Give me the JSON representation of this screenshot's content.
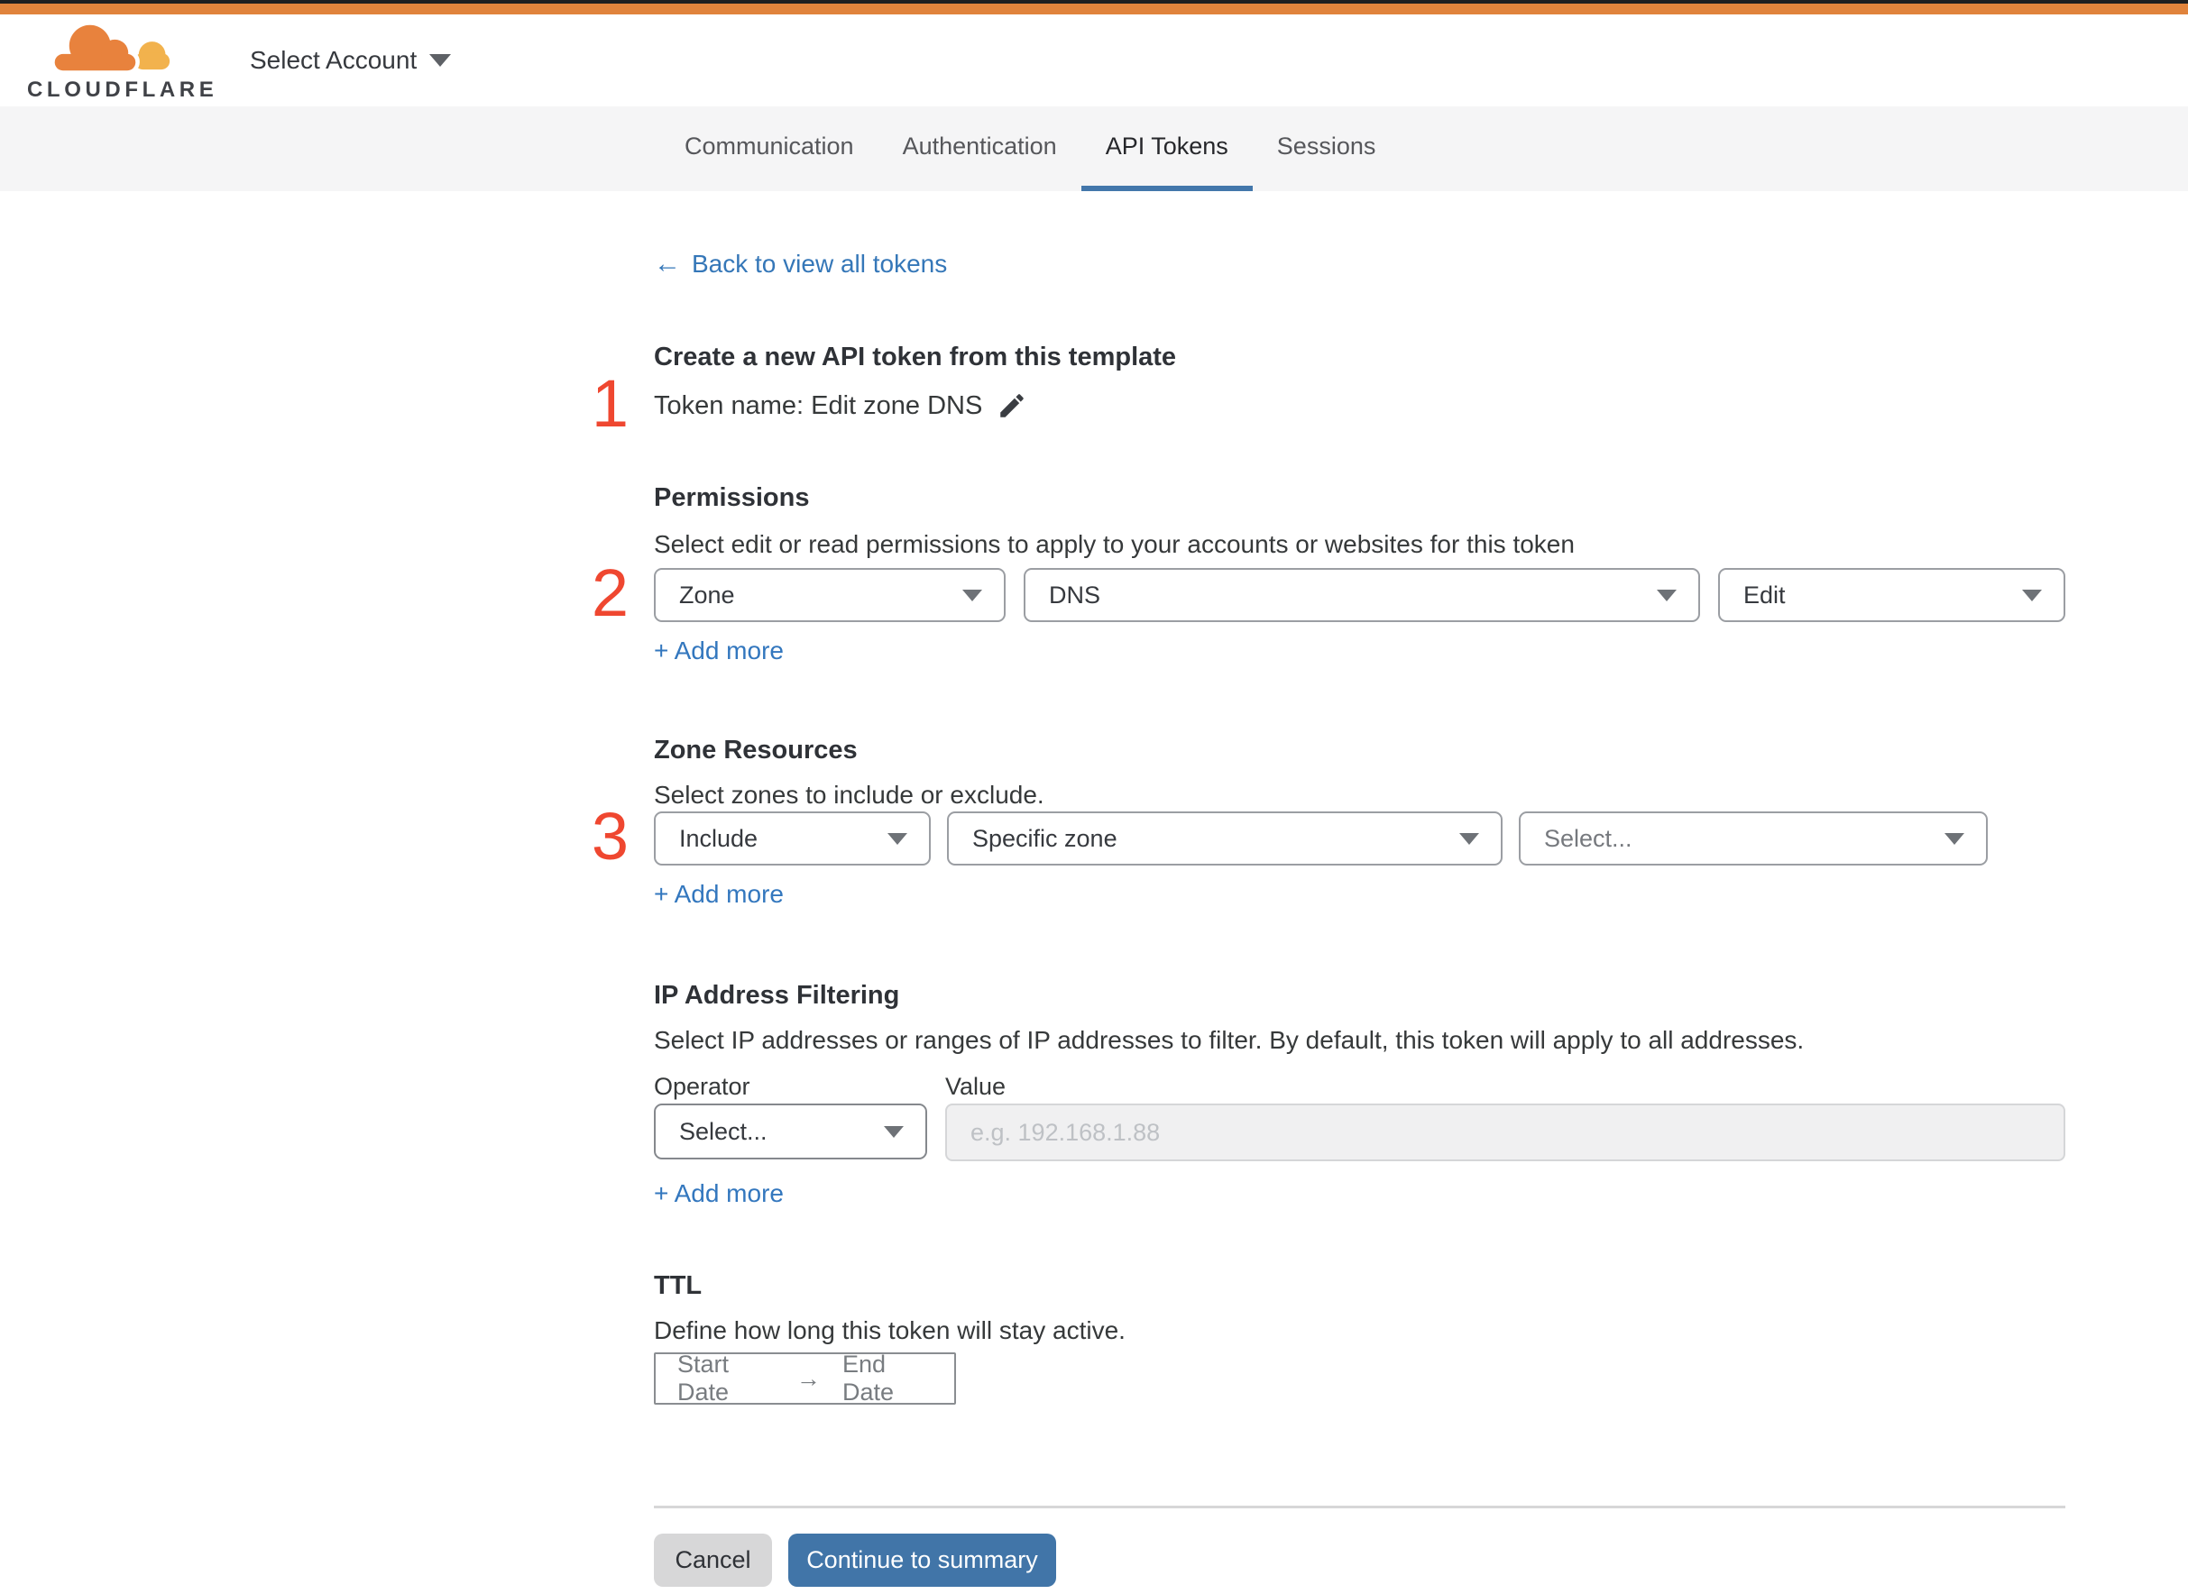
{
  "header": {
    "brand": "CLOUDFLARE",
    "account_selector": "Select Account"
  },
  "tabs": [
    {
      "label": "Communication",
      "active": false
    },
    {
      "label": "Authentication",
      "active": false
    },
    {
      "label": "API Tokens",
      "active": true
    },
    {
      "label": "Sessions",
      "active": false
    }
  ],
  "back_link": {
    "arrow": "←",
    "label": "Back to view all tokens"
  },
  "steps": [
    "1",
    "2",
    "3"
  ],
  "template_section": {
    "title": "Create a new API token from this template",
    "token_name_line": "Token name: Edit zone DNS"
  },
  "permissions": {
    "title": "Permissions",
    "description": "Select edit or read permissions to apply to your accounts or websites for this token",
    "selects": [
      {
        "value": "Zone"
      },
      {
        "value": "DNS"
      },
      {
        "value": "Edit"
      }
    ],
    "add_more": "+ Add more"
  },
  "zone_resources": {
    "title": "Zone Resources",
    "description": "Select zones to include or exclude.",
    "selects": [
      {
        "value": "Include"
      },
      {
        "value": "Specific zone"
      },
      {
        "value": "Select..."
      }
    ],
    "add_more": "+ Add more"
  },
  "ip_filtering": {
    "title": "IP Address Filtering",
    "description": "Select IP addresses or ranges of IP addresses to filter. By default, this token will apply to all addresses.",
    "operator_label": "Operator",
    "value_label": "Value",
    "operator_value": "Select...",
    "value_placeholder": "e.g. 192.168.1.88",
    "add_more": "+ Add more"
  },
  "ttl": {
    "title": "TTL",
    "description": "Define how long this token will stay active.",
    "start_label": "Start Date",
    "arrow": "→",
    "end_label": "End Date"
  },
  "footer": {
    "cancel_label": "Cancel",
    "continue_label": "Continue to summary"
  },
  "colors": {
    "top_bar_orange": "#e0833c",
    "brand_cloud_orange": "#e8823d",
    "brand_cloud_gold": "#f2b24d",
    "link_blue": "#3377be",
    "tab_underline_blue": "#4377ab",
    "continue_button_blue": "#4175a8",
    "step_number_red": "#ef4730",
    "tabbar_gray": "#f5f5f6",
    "disabled_input_gray": "#f0f0f1"
  }
}
